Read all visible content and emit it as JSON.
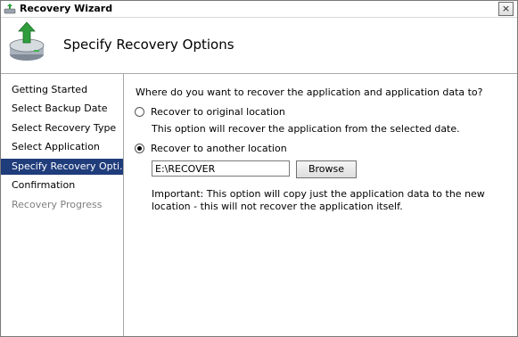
{
  "window": {
    "title": "Recovery Wizard",
    "close_glyph": "×"
  },
  "header": {
    "title": "Specify Recovery Options",
    "icon": "recovery-disk-icon"
  },
  "steps": [
    {
      "label": "Getting Started",
      "state": "normal"
    },
    {
      "label": "Select Backup Date",
      "state": "normal"
    },
    {
      "label": "Select Recovery Type",
      "state": "normal"
    },
    {
      "label": "Select Application",
      "state": "normal"
    },
    {
      "label": "Specify Recovery Opti...",
      "state": "active"
    },
    {
      "label": "Confirmation",
      "state": "normal"
    },
    {
      "label": "Recovery Progress",
      "state": "disabled"
    }
  ],
  "content": {
    "question": "Where do you want to recover the application and application data to?",
    "option_original": {
      "label": "Recover to original location",
      "description": "This option will recover the application from the selected date.",
      "selected": false
    },
    "option_another": {
      "label": "Recover to another location",
      "selected": true
    },
    "path_value": "E:\\RECOVER",
    "browse_label": "Browse",
    "important": "Important: This option will copy just the application data to the new location - this will not recover the application itself."
  },
  "colors": {
    "active_step_bg": "#1f3c7b",
    "border": "#a8a8a8"
  }
}
